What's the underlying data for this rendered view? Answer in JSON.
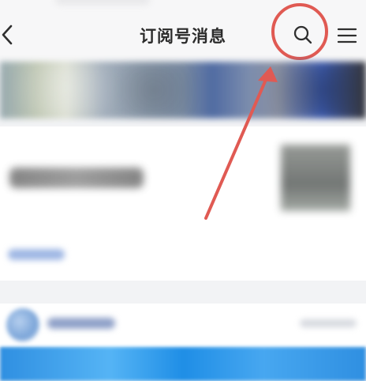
{
  "header": {
    "title": "订阅号消息"
  },
  "icons": {
    "back": "chevron-left-icon",
    "search": "search-icon",
    "menu": "menu-icon"
  },
  "colors": {
    "highlight": "#e05a53",
    "title": "#2b2b2b",
    "accent_blue": "#2f8fe1"
  }
}
